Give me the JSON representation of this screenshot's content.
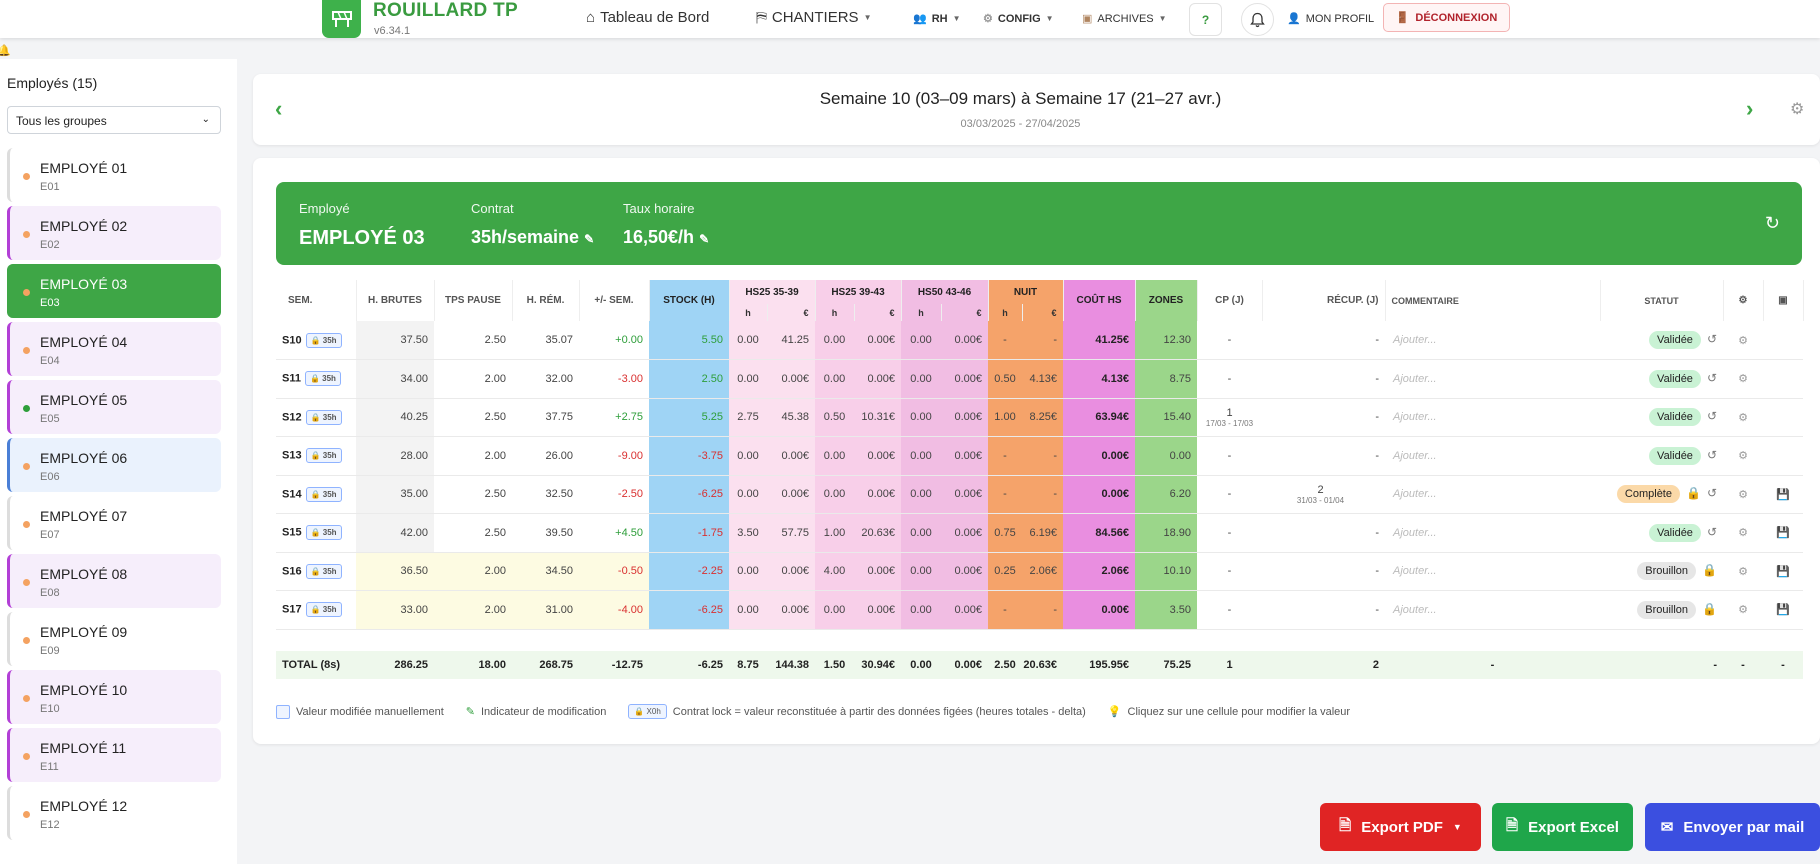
{
  "app": {
    "name": "ROUILLARD TP",
    "version": "v6.34.1"
  },
  "nav": {
    "dashboard": "Tableau de Bord",
    "chantiers": "CHANTIERS",
    "rh": "RH",
    "config": "CONFIG",
    "archives": "ARCHIVES",
    "help": "?",
    "profile": "MON PROFIL",
    "logout": "DÉCONNEXION"
  },
  "sidebar": {
    "title": "Employés (15)",
    "group_filter": "Tous les groupes",
    "employees": [
      {
        "name": "EMPLOYÉ 01",
        "code": "E01",
        "accent": "#dddddd",
        "bg": "#ffffff",
        "dot": "#f4a261"
      },
      {
        "name": "EMPLOYÉ 02",
        "code": "E02",
        "accent": "#b23fd6",
        "bg": "#f6eefb",
        "dot": "#f4a261"
      },
      {
        "name": "EMPLOYÉ 03",
        "code": "E03",
        "accent": "#3ea646",
        "bg": "#3ea646",
        "dot": "#f4a261",
        "selected": true
      },
      {
        "name": "EMPLOYÉ 04",
        "code": "E04",
        "accent": "#b23fd6",
        "bg": "#f6eefb",
        "dot": "#f4a261"
      },
      {
        "name": "EMPLOYÉ 05",
        "code": "E05",
        "accent": "#b23fd6",
        "bg": "#f6eefb",
        "dot": "#2e9e3a"
      },
      {
        "name": "EMPLOYÉ 06",
        "code": "E06",
        "accent": "#4a7fd6",
        "bg": "#eaf2fd",
        "dot": "#f4a261"
      },
      {
        "name": "EMPLOYÉ 07",
        "code": "E07",
        "accent": "#dddddd",
        "bg": "#ffffff",
        "dot": "#f4a261"
      },
      {
        "name": "EMPLOYÉ 08",
        "code": "E08",
        "accent": "#b23fd6",
        "bg": "#f6eefb",
        "dot": "#f4a261"
      },
      {
        "name": "EMPLOYÉ 09",
        "code": "E09",
        "accent": "#dddddd",
        "bg": "#ffffff",
        "dot": "#f4a261"
      },
      {
        "name": "EMPLOYÉ 10",
        "code": "E10",
        "accent": "#b23fd6",
        "bg": "#f6eefb",
        "dot": "#f4a261"
      },
      {
        "name": "EMPLOYÉ 11",
        "code": "E11",
        "accent": "#b23fd6",
        "bg": "#f6eefb",
        "dot": "#f4a261"
      },
      {
        "name": "EMPLOYÉ 12",
        "code": "E12",
        "accent": "#dddddd",
        "bg": "#ffffff",
        "dot": "#f4a261"
      }
    ]
  },
  "period": {
    "title": "Semaine 10 (03–09 mars) à Semaine 17 (21–27 avr.)",
    "dates": "03/03/2025 - 27/04/2025"
  },
  "banner": {
    "employee_label": "Employé",
    "employee_value": "EMPLOYÉ 03",
    "contract_label": "Contrat",
    "contract_value": "35h/semaine",
    "rate_label": "Taux horaire",
    "rate_value": "16,50€/h"
  },
  "table": {
    "headers": {
      "sem": "SEM.",
      "brutes": "H. BRUTES",
      "pause": "TPS PAUSE",
      "rem": "H. RÉM.",
      "delta": "+/- SEM.",
      "stock": "STOCK (H)",
      "hs25a": "HS25 35-39",
      "hs25b": "HS25 39-43",
      "hs50": "HS50 43-46",
      "nuit": "NUIT",
      "cout": "COÛT HS",
      "zones": "ZONES",
      "cp": "CP (J)",
      "recup": "RÉCUP. (J)",
      "comment": "COMMENTAIRE",
      "statut": "STATUT",
      "h": "h",
      "eur": "€"
    },
    "rows": [
      {
        "sem": "S10",
        "lock": "35h",
        "brutes": "37.50",
        "pause": "2.50",
        "rem": "35.07",
        "delta": "+0.00",
        "stock": "5.50",
        "hs25a_h": "0.00",
        "hs25a_e": "41.25",
        "hs25b_h": "0.00",
        "hs25b_e": "0.00€",
        "hs50_h": "0.00",
        "hs50_e": "0.00€",
        "nuit_h": "-",
        "nuit_e": "-",
        "cout": "41.25€",
        "zones": "12.30",
        "cp": "-",
        "cp_range": "",
        "recup": "-",
        "recup_range": "",
        "comment": "Ajouter...",
        "status": "Validée",
        "status_kind": "v"
      },
      {
        "sem": "S11",
        "lock": "35h",
        "brutes": "34.00",
        "pause": "2.00",
        "rem": "32.00",
        "delta": "-3.00",
        "stock": "2.50",
        "hs25a_h": "0.00",
        "hs25a_e": "0.00€",
        "hs25b_h": "0.00",
        "hs25b_e": "0.00€",
        "hs50_h": "0.00",
        "hs50_e": "0.00€",
        "nuit_h": "0.50",
        "nuit_e": "4.13€",
        "cout": "4.13€",
        "zones": "8.75",
        "cp": "-",
        "cp_range": "",
        "recup": "-",
        "recup_range": "",
        "comment": "Ajouter...",
        "status": "Validée",
        "status_kind": "v"
      },
      {
        "sem": "S12",
        "lock": "35h",
        "brutes": "40.25",
        "pause": "2.50",
        "rem": "37.75",
        "delta": "+2.75",
        "stock": "5.25",
        "hs25a_h": "2.75",
        "hs25a_e": "45.38",
        "hs25b_h": "0.50",
        "hs25b_e": "10.31€",
        "hs50_h": "0.00",
        "hs50_e": "0.00€",
        "nuit_h": "1.00",
        "nuit_e": "8.25€",
        "cout": "63.94€",
        "zones": "15.40",
        "cp": "1",
        "cp_range": "17/03 - 17/03",
        "recup": "-",
        "recup_range": "",
        "comment": "Ajouter...",
        "status": "Validée",
        "status_kind": "v"
      },
      {
        "sem": "S13",
        "lock": "35h",
        "brutes": "28.00",
        "pause": "2.00",
        "rem": "26.00",
        "delta": "-9.00",
        "stock": "-3.75",
        "hs25a_h": "0.00",
        "hs25a_e": "0.00€",
        "hs25b_h": "0.00",
        "hs25b_e": "0.00€",
        "hs50_h": "0.00",
        "hs50_e": "0.00€",
        "nuit_h": "-",
        "nuit_e": "-",
        "cout": "0.00€",
        "zones": "0.00",
        "cp": "-",
        "cp_range": "",
        "recup": "-",
        "recup_range": "",
        "comment": "Ajouter...",
        "status": "Validée",
        "status_kind": "v"
      },
      {
        "sem": "S14",
        "lock": "35h",
        "brutes": "35.00",
        "pause": "2.50",
        "rem": "32.50",
        "delta": "-2.50",
        "stock": "-6.25",
        "hs25a_h": "0.00",
        "hs25a_e": "0.00€",
        "hs25b_h": "0.00",
        "hs25b_e": "0.00€",
        "hs50_h": "0.00",
        "hs50_e": "0.00€",
        "nuit_h": "-",
        "nuit_e": "-",
        "cout": "0.00€",
        "zones": "6.20",
        "cp": "-",
        "cp_range": "",
        "recup": "2",
        "recup_range": "31/03 - 01/04",
        "comment": "Ajouter...",
        "status": "Complète",
        "status_kind": "c"
      },
      {
        "sem": "S15",
        "lock": "35h",
        "brutes": "42.00",
        "pause": "2.50",
        "rem": "39.50",
        "delta": "+4.50",
        "stock": "-1.75",
        "hs25a_h": "3.50",
        "hs25a_e": "57.75",
        "hs25b_h": "1.00",
        "hs25b_e": "20.63€",
        "hs50_h": "0.00",
        "hs50_e": "0.00€",
        "nuit_h": "0.75",
        "nuit_e": "6.19€",
        "cout": "84.56€",
        "zones": "18.90",
        "cp": "-",
        "cp_range": "",
        "recup": "-",
        "recup_range": "",
        "comment": "Ajouter...",
        "status": "Validée",
        "status_kind": "v"
      },
      {
        "sem": "S16",
        "lock": "35h",
        "brutes": "36.50",
        "pause": "2.00",
        "rem": "34.50",
        "delta": "-0.50",
        "stock": "-2.25",
        "hs25a_h": "0.00",
        "hs25a_e": "0.00€",
        "hs25b_h": "4.00",
        "hs25b_e": "0.00€",
        "hs50_h": "0.00",
        "hs50_e": "0.00€",
        "nuit_h": "0.25",
        "nuit_e": "2.06€",
        "cout": "2.06€",
        "zones": "10.10",
        "cp": "-",
        "cp_range": "",
        "recup": "-",
        "recup_range": "",
        "comment": "Ajouter...",
        "status": "Brouillon",
        "status_kind": "b"
      },
      {
        "sem": "S17",
        "lock": "35h",
        "brutes": "33.00",
        "pause": "2.00",
        "rem": "31.00",
        "delta": "-4.00",
        "stock": "-6.25",
        "hs25a_h": "0.00",
        "hs25a_e": "0.00€",
        "hs25b_h": "0.00",
        "hs25b_e": "0.00€",
        "hs50_h": "0.00",
        "hs50_e": "0.00€",
        "nuit_h": "-",
        "nuit_e": "-",
        "cout": "0.00€",
        "zones": "3.50",
        "cp": "-",
        "cp_range": "",
        "recup": "-",
        "recup_range": "",
        "comment": "Ajouter...",
        "status": "Brouillon",
        "status_kind": "b"
      }
    ],
    "total": {
      "label": "TOTAL (8s)",
      "brutes": "286.25",
      "pause": "18.00",
      "rem": "268.75",
      "delta": "-12.75",
      "stock": "-6.25",
      "hs25a_h": "8.75",
      "hs25a_e": "144.38",
      "hs25b_h": "1.50",
      "hs25b_e": "30.94€",
      "hs50_h": "0.00",
      "hs50_e": "0.00€",
      "nuit_h": "2.50",
      "nuit_e": "20.63€",
      "cout": "195.95€",
      "zones": "75.25",
      "cp": "1",
      "recup": "2",
      "comment": "-",
      "statut": "-",
      "c1": "-",
      "c2": "-"
    }
  },
  "legend": {
    "manual": "Valeur modifiée manuellement",
    "indicator": "Indicateur de modification",
    "lock_badge": "X0h",
    "lock_text": "Contrat lock = valeur reconstituée à partir des données figées (heures totales - delta)",
    "tip": "Cliquez sur une cellule pour modifier la valeur"
  },
  "actions": {
    "pdf": "Export PDF",
    "excel": "Export Excel",
    "mail": "Envoyer par mail"
  },
  "colors": {
    "brand_green": "#3ea646",
    "danger_red": "#e02424",
    "excel_green": "#1fa64a",
    "mail_blue": "#3b4fe0"
  }
}
